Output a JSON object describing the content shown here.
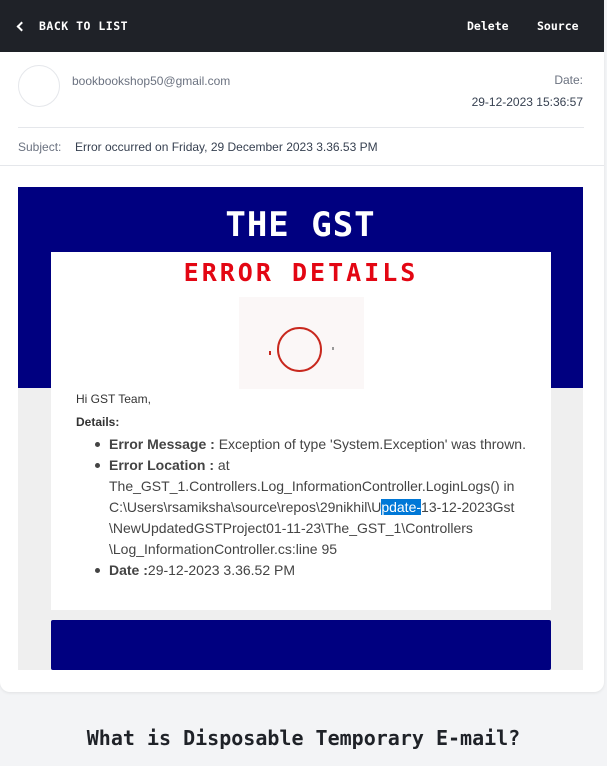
{
  "topbar": {
    "back_label": "BACK TO LIST",
    "delete_label": "Delete",
    "source_label": "Source"
  },
  "message": {
    "from": "bookbookshop50@gmail.com",
    "date_label": "Date:",
    "date_value": "29-12-2023 15:36:57",
    "subject_label": "Subject:",
    "subject_value": "Error occurred on Friday, 29 December 2023 3.36.53 PM"
  },
  "email_body": {
    "title": "THE GST",
    "error_title": "ERROR DETAILS",
    "greeting": "Hi GST Team,",
    "details_label": "Details:",
    "items": [
      {
        "key": "Error Message :",
        "value": " Exception of type 'System.Exception' was thrown."
      },
      {
        "key": "Error Location :",
        "value_before": " at The_GST_1.Controllers.Log_InformationController.LoginLogs() in C:\\Users\\rsamiksha\\source\\repos\\29nikhil\\U",
        "value_highlight": "pdate-",
        "value_after": "13-12-2023Gst \\NewUpdatedGSTProject01-11-23\\The_GST_1\\Controllers \\Log_InformationController.cs:line 95"
      },
      {
        "key": "Date :",
        "value": "29-12-2023 3.36.52 PM"
      }
    ]
  },
  "bottom": {
    "heading": "What is Disposable Temporary E-mail?"
  },
  "colors": {
    "topbar": "#1f2228",
    "email_header": "#000080",
    "error_red": "#e30613",
    "selection": "#0078d7"
  }
}
